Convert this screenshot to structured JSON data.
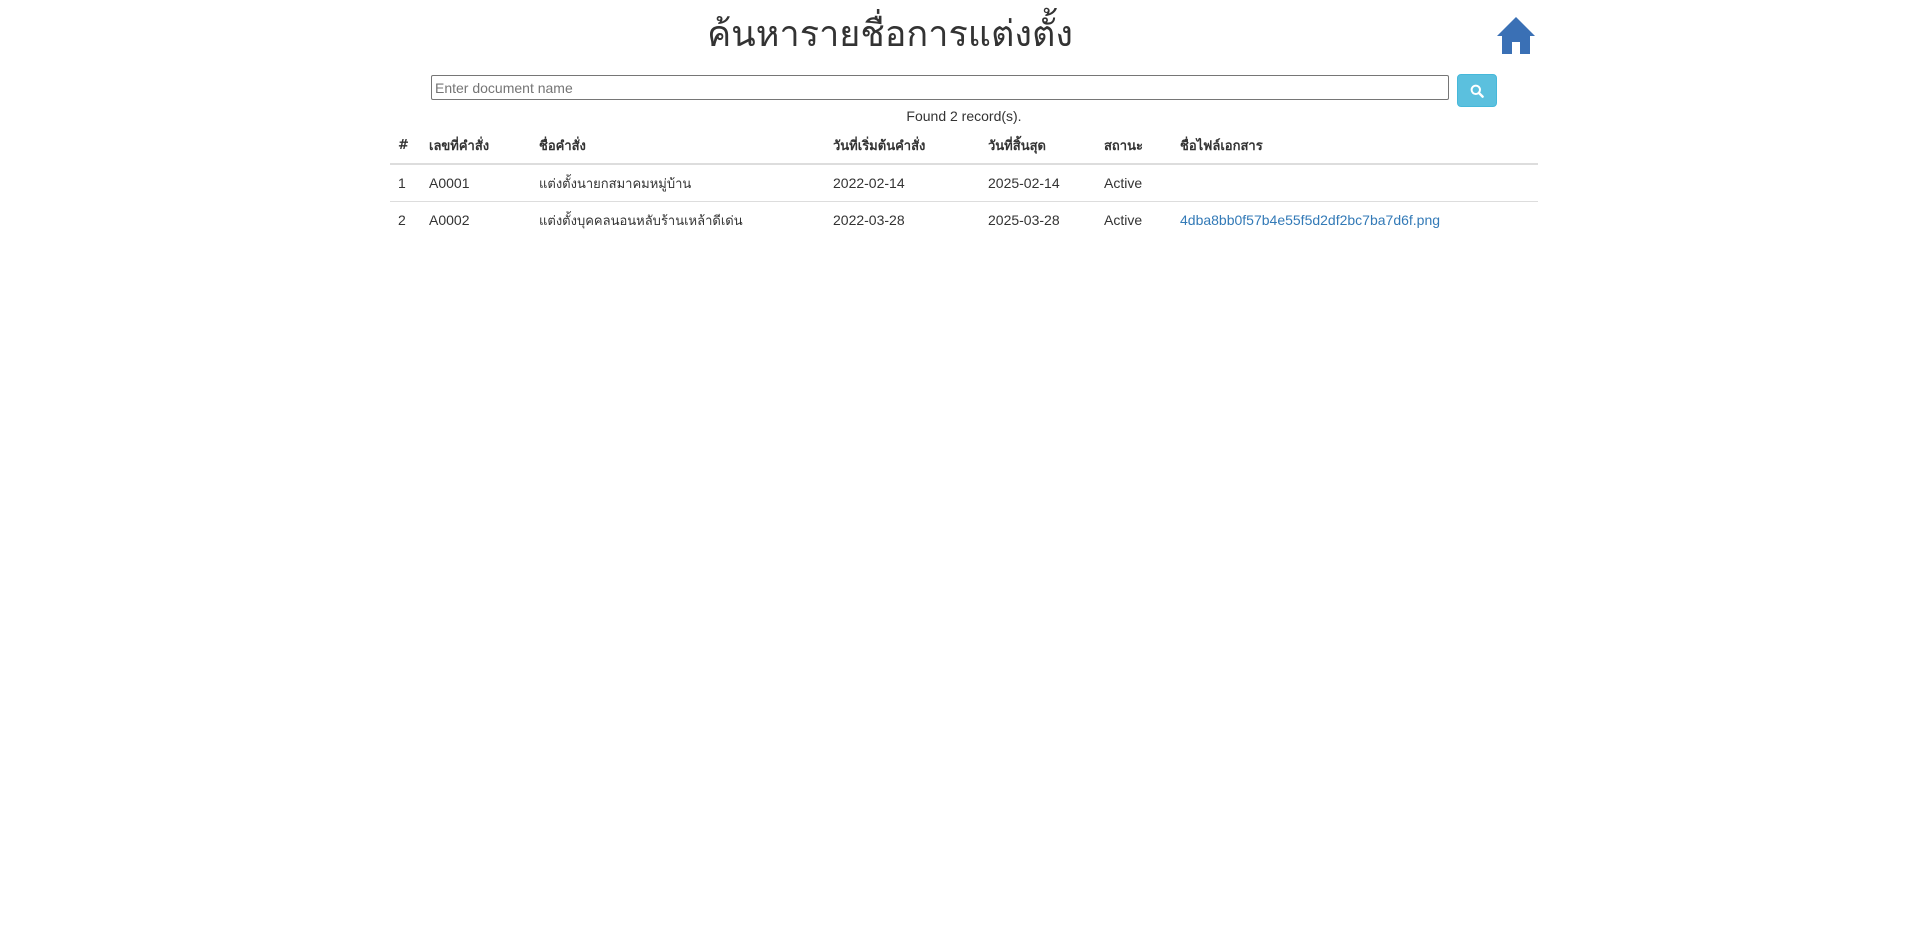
{
  "header": {
    "title": "ค้นหารายชื่อการแต่งตั้ง",
    "home_icon": "home-icon",
    "home_color": "#3a70b5"
  },
  "search": {
    "value": "",
    "placeholder": "Enter document name",
    "button_icon": "search-icon",
    "button_color": "#5bc0de"
  },
  "results": {
    "count_text": "Found 2 record(s).",
    "columns": [
      "#",
      "เลขที่คำสั่ง",
      "ชื่อคำสั่ง",
      "วันที่เริ่มต้นคำสั่ง",
      "วันที่สิ้นสุด",
      "สถานะ",
      "ชื่อไฟล์เอกสาร"
    ],
    "rows": [
      {
        "index": "1",
        "order_no": "A0001",
        "order_name": "แต่งตั้งนายกสมาคมหมู่บ้าน",
        "start_date": "2022-02-14",
        "end_date": "2025-02-14",
        "status": "Active",
        "file_name": ""
      },
      {
        "index": "2",
        "order_no": "A0002",
        "order_name": "แต่งตั้งบุคคลนอนหลับร้านเหล้าดีเด่น",
        "start_date": "2022-03-28",
        "end_date": "2025-03-28",
        "status": "Active",
        "file_name": "4dba8bb0f57b4e55f5d2df2bc7ba7d6f.png"
      }
    ]
  },
  "colors": {
    "link": "#337ab7",
    "text": "#333333",
    "border": "#dddddd"
  }
}
